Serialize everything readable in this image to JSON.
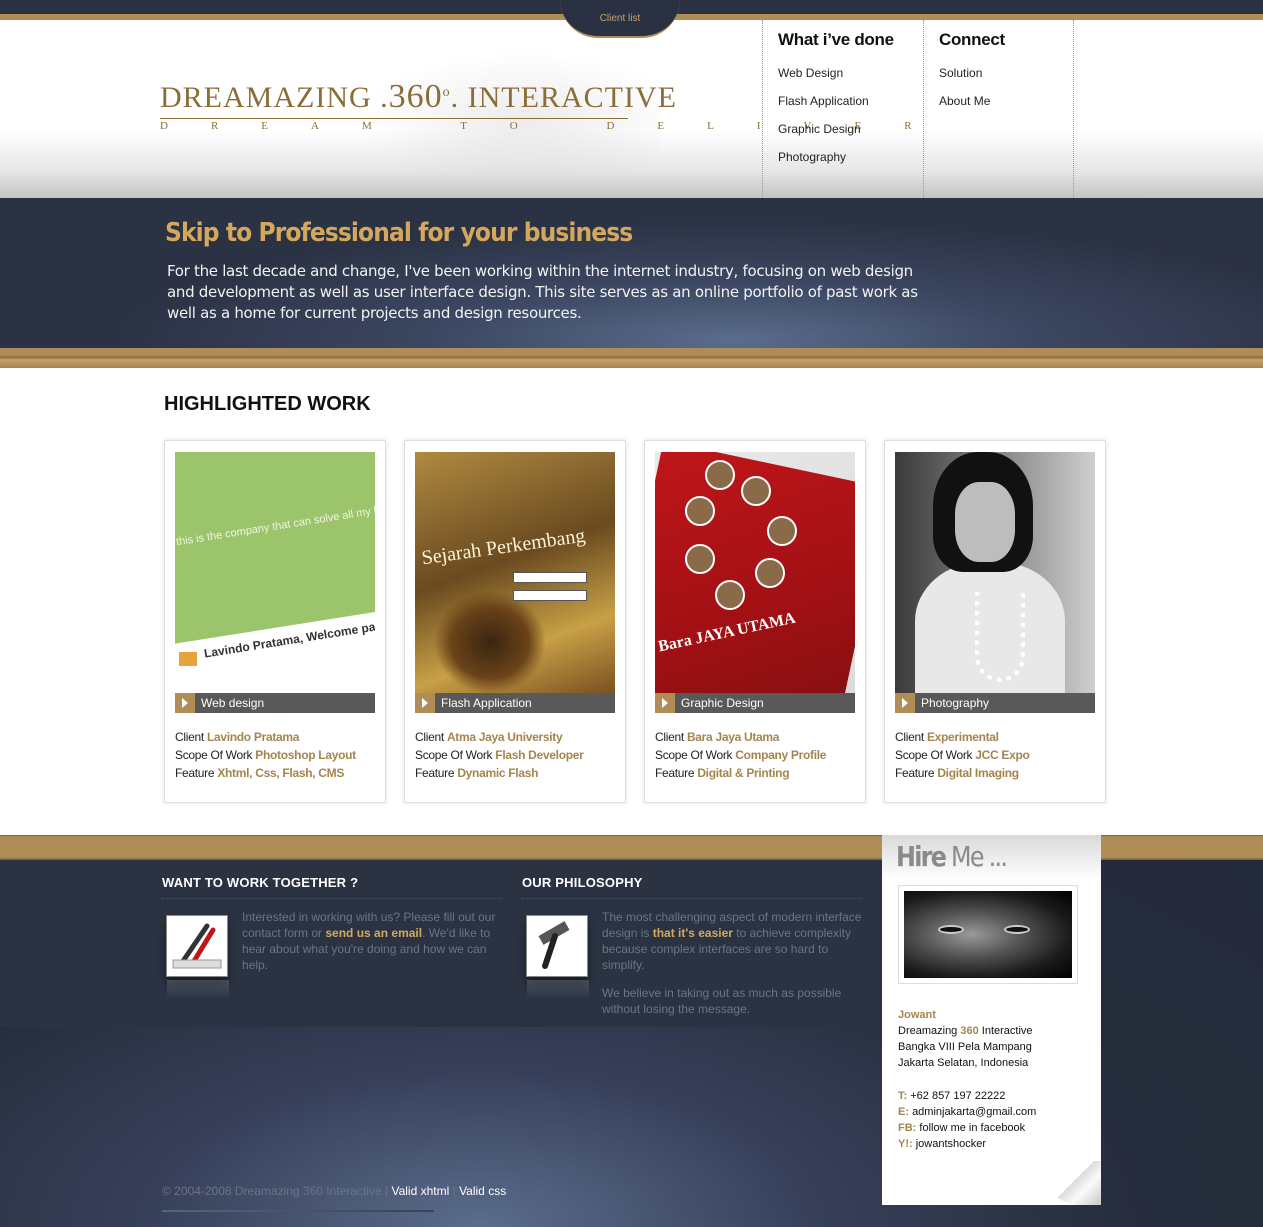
{
  "header": {
    "client_list": "Client list",
    "logo": {
      "word1": "DREAMAZING",
      "dot": ".",
      "number": "360",
      "degree": "o",
      "dot2": ".",
      "word2": "INTERACTIVE",
      "tagline": "DREAM TO DELIVER"
    },
    "nav": [
      {
        "heading": "What i’ve done",
        "items": [
          "Web Design",
          "Flash Application",
          "Graphic Design",
          "Photography"
        ]
      },
      {
        "heading": "Connect",
        "items": [
          "Solution",
          "About Me"
        ]
      }
    ]
  },
  "banner": {
    "title": "Skip to Professional for your business",
    "text": "For the last decade and change, I've been working within the internet industry, focusing on web design and development as well as user interface design. This site serves as an online portfolio of past work as well as a home for current projects and design resources."
  },
  "highlighted": {
    "title": "HIGHLIGHTED WORK",
    "labels": {
      "client": "Client",
      "scope": "Scope Of Work",
      "feature": "Feature"
    },
    "cards": [
      {
        "category": "Web design",
        "client": "Lavindo Pratama",
        "scope": "Photoshop Layout",
        "feature": "Xhtml, Css, Flash, CMS",
        "thumb_text": "this is the company that can solve all my land",
        "thumb_title": "Lavindo Pratama, Welcome page"
      },
      {
        "category": "Flash Application",
        "client": "Atma Jaya University",
        "scope": "Flash Developer",
        "feature": "Dynamic Flash",
        "thumb_text": "Sejarah Perkembang"
      },
      {
        "category": "Graphic Design",
        "client": "Bara Jaya Utama",
        "scope": "Company Profile",
        "feature": "Digital & Printing",
        "thumb_text": "Bara JAYA UTAMA"
      },
      {
        "category": "Photography",
        "client": "Experimental",
        "scope": "JCC Expo",
        "feature": "Digital Imaging"
      }
    ]
  },
  "footer": {
    "work": {
      "title": "WANT TO WORK TOGETHER ?",
      "text_before": "Interested in working with us? Please fill out our contact form or ",
      "link": "send us an email",
      "text_after": ". We'd like to hear about what you're doing and how we can help."
    },
    "philosophy": {
      "title": "OUR PHILOSOPHY",
      "p1_before": "The most challenging aspect of modern interface design is ",
      "p1_link": "that it's easier",
      "p1_after": " to achieve complexity because complex interfaces are so hard to simplify.",
      "p2": "We believe in taking out as much as possible without losing the message."
    },
    "copyright": "© 2004-2008 Dreamazing 360 Interactive",
    "sep": "|",
    "valid_xhtml": "Valid xhtml",
    "valid_css": "Valid css"
  },
  "hire": {
    "title_bold": "Hire",
    "title_rest": " Me ...",
    "name": "Jowant",
    "company_before": "Dreamazing ",
    "company_num": "360",
    "company_after": " Interactive",
    "address1": "Bangka VIII Pela Mampang",
    "address2": "Jakarta Selatan, Indonesia",
    "contacts": [
      {
        "label": "T:",
        "value": "+62 857 197 22222"
      },
      {
        "label": "E:",
        "value": "adminjakarta@gmail.com"
      },
      {
        "label": "FB:",
        "value": "follow me in facebook"
      },
      {
        "label": "Y!:",
        "value": "jowantshocker"
      }
    ]
  },
  "colors": {
    "gold": "#b08d57",
    "navy": "#2a3142",
    "accent_text": "#d4a85c"
  }
}
